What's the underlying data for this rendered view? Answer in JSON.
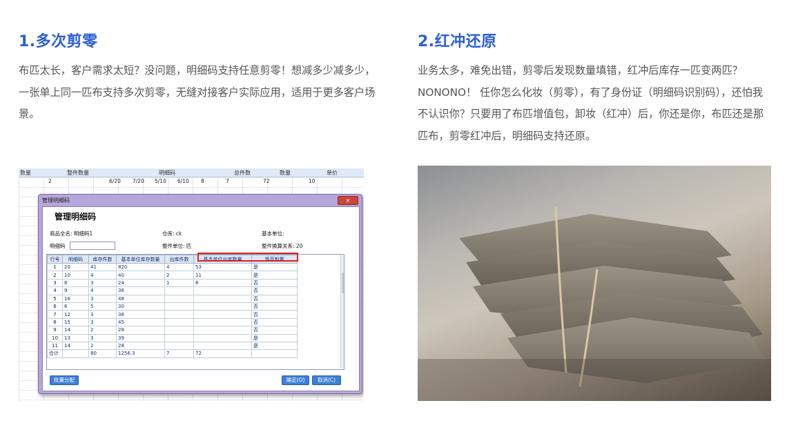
{
  "left": {
    "heading": "1.多次剪零",
    "para": "布匹太长，客户需求太短？没问题，明细码支持任意剪零！想减多少减多少，一张单上同一匹布支持多次剪零，无缝对接客户实际应用，适用于更多客户场景。"
  },
  "right": {
    "heading": "2.红冲还原",
    "para": "业务太多，难免出错，剪零后发现数量填错，红冲后库存一匹变两匹？NONONO！ 任你怎么化妆（剪零），有了身份证（明细码识别码），还怕我不认识你？只要用了布匹增值包，卸妆（红冲）后，你还是你，布匹还是那匹布，剪零红冲后，明细码支持还原。"
  },
  "sheet": {
    "headers": [
      "数量",
      "整件数量",
      "明细码",
      "总件数",
      "数量",
      "单价"
    ],
    "row": [
      "2",
      "6/20",
      "7/20",
      "5/10",
      "6/10",
      "8",
      "7",
      "72",
      "10"
    ]
  },
  "dialog": {
    "title": "管理明细码",
    "close": "×",
    "header": "管理明细码",
    "product_label": "商品全名: 明细码1",
    "warehouse_label": "仓库: ck",
    "base_unit_label": "基本单位:",
    "code_label": "明细码",
    "pack_unit_label": "整件单位: 匹",
    "conversion_label": "整件换算关系: 20",
    "columns": [
      "行号",
      "明细码",
      "库存件数",
      "基本单位库存数量",
      "出库件数",
      "基本单位出库数量",
      "是否剪零"
    ],
    "rows": [
      [
        "1",
        "20",
        "41",
        "820",
        "4",
        "53",
        "是"
      ],
      [
        "2",
        "10",
        "4",
        "40",
        "2",
        "11",
        "是"
      ],
      [
        "3",
        "8",
        "3",
        "24",
        "1",
        "8",
        "否"
      ],
      [
        "4",
        "9",
        "4",
        "36",
        "",
        "",
        "否"
      ],
      [
        "5",
        "16",
        "3",
        "48",
        "",
        "",
        "否"
      ],
      [
        "6",
        "6",
        "5",
        "30",
        "",
        "",
        "否"
      ],
      [
        "7",
        "12",
        "3",
        "36",
        "",
        "",
        "否"
      ],
      [
        "8",
        "15",
        "3",
        "45",
        "",
        "",
        "否"
      ],
      [
        "9",
        "14",
        "2",
        "28",
        "",
        "",
        "否"
      ],
      [
        "10",
        "13",
        "3",
        "39",
        "",
        "",
        "是"
      ],
      [
        "11",
        "14",
        "2",
        "28",
        "",
        "",
        "是"
      ]
    ],
    "total": [
      "合计",
      "",
      "80",
      "1256.3",
      "7",
      "72",
      ""
    ],
    "batch_button": "批量分配",
    "ok_button": "确定(O)",
    "cancel_button": "取消(C)"
  },
  "colors": {
    "heading": "#2b5fd6",
    "highlight": "#e02020",
    "button": "#3d7fd8"
  }
}
